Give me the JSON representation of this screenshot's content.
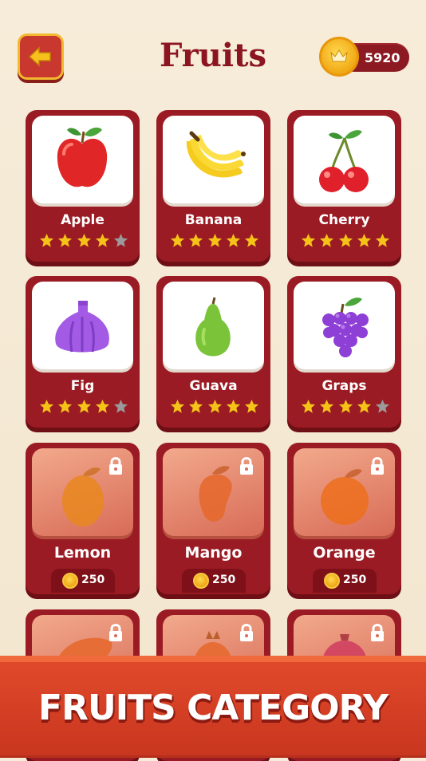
{
  "header": {
    "title": "Fruits",
    "coins": "5920"
  },
  "colors": {
    "card": "#9b1b24",
    "star_on": "#f5c318",
    "star_off": "#9a9a9a",
    "banner": "#d63d24"
  },
  "cards": [
    {
      "name": "Apple",
      "icon": "apple-icon",
      "rating": 4,
      "locked": false
    },
    {
      "name": "Banana",
      "icon": "banana-icon",
      "rating": 5,
      "locked": false
    },
    {
      "name": "Cherry",
      "icon": "cherry-icon",
      "rating": 5,
      "locked": false
    },
    {
      "name": "Fig",
      "icon": "fig-icon",
      "rating": 4,
      "locked": false
    },
    {
      "name": "Guava",
      "icon": "guava-icon",
      "rating": 5,
      "locked": false
    },
    {
      "name": "Graps",
      "icon": "grapes-icon",
      "rating": 4,
      "locked": false
    },
    {
      "name": "Lemon",
      "icon": "lemon-icon",
      "locked": true,
      "price": "250"
    },
    {
      "name": "Mango",
      "icon": "mango-icon",
      "locked": true,
      "price": "250"
    },
    {
      "name": "Orange",
      "icon": "orange-icon",
      "locked": true,
      "price": "250"
    },
    {
      "icon": "papaya-icon",
      "locked": true
    },
    {
      "icon": "pineapple-icon",
      "locked": true
    },
    {
      "icon": "pomegranate-icon",
      "locked": true
    }
  ],
  "banner": {
    "text": "FRUITS CATEGORY"
  }
}
